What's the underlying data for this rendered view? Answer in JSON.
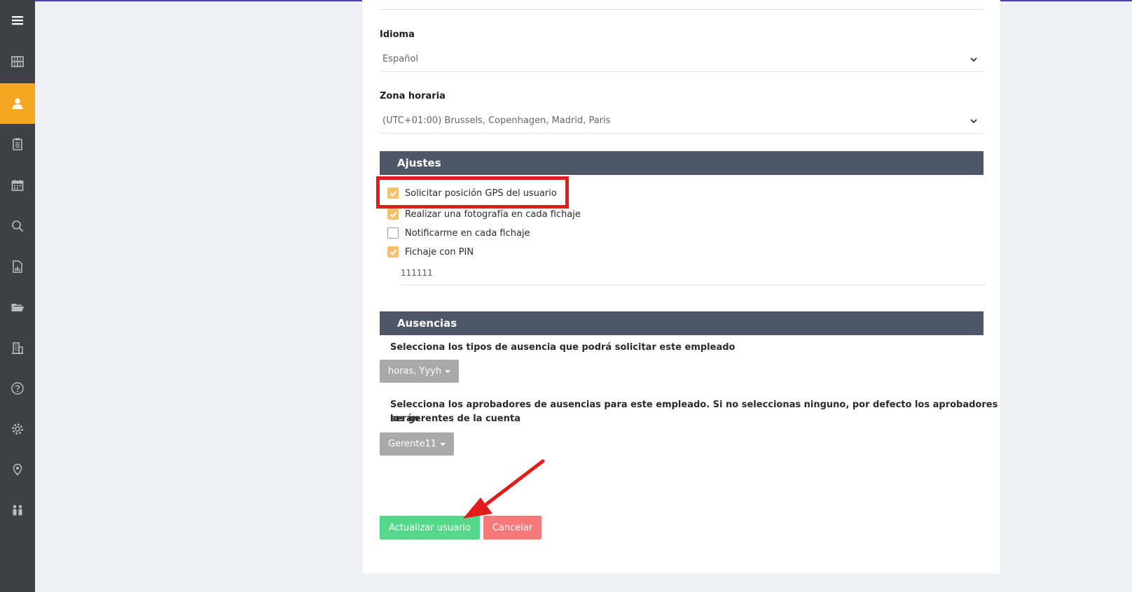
{
  "sidebar": {
    "items": [
      {
        "icon": "menu-icon"
      },
      {
        "icon": "dashboard-icon"
      },
      {
        "icon": "user-icon",
        "active": true
      },
      {
        "icon": "clipboard-icon"
      },
      {
        "icon": "calendar-icon"
      },
      {
        "icon": "search-icon"
      },
      {
        "icon": "report-icon"
      },
      {
        "icon": "folder-icon"
      },
      {
        "icon": "building-icon"
      },
      {
        "icon": "help-icon"
      },
      {
        "icon": "gear-icon"
      },
      {
        "icon": "location-icon"
      },
      {
        "icon": "people-icon"
      }
    ],
    "active_color": "#f5a623"
  },
  "form": {
    "language": {
      "label": "Idioma",
      "value": "Español"
    },
    "timezone": {
      "label": "Zona horaria",
      "value": "(UTC+01:00) Brussels, Copenhagen, Madrid, Paris"
    },
    "settings": {
      "title": "Ajustes",
      "options": [
        {
          "label": "Solicitar posición GPS del usuario",
          "checked": true
        },
        {
          "label": "Realizar una fotografía en cada fichaje",
          "checked": true
        },
        {
          "label": "Notificarme en cada fichaje",
          "checked": false
        },
        {
          "label": "Fichaje con PIN",
          "checked": true
        }
      ],
      "pin_value": "111111"
    },
    "absences": {
      "title": "Ausencias",
      "types_desc": "Selecciona los tipos de ausencia que podrá solicitar este empleado",
      "types_value": "horas, Yyyh",
      "approvers_desc_line1": "Selecciona los aprobadores de ausencias para este empleado. Si no seleccionas ninguno, por defecto los aprobadores serán",
      "approvers_desc_line2": "los gerentes de la cuenta",
      "approvers_value": "Gerente11"
    },
    "buttons": {
      "update": "Actualizar usuario",
      "cancel": "Cancelar"
    }
  },
  "annotation_color": "#e21b1b"
}
